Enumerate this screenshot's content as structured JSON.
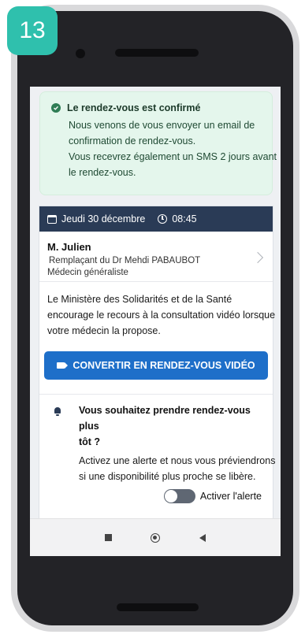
{
  "step_badge": "13",
  "confirmation": {
    "title": "Le rendez-vous est confirmé",
    "lines": [
      "Nous venons de vous envoyer un email de",
      "confirmation de rendez-vous.",
      "Vous recevrez également un SMS 2 jours avant",
      "le rendez-vous."
    ]
  },
  "appointment": {
    "date": "Jeudi 30 décembre",
    "time": "08:45",
    "doctor_name": "M. Julien",
    "doctor_role": "Remplaçant du Dr Mehdi PABAUBOT",
    "specialty": "Médecin généraliste"
  },
  "video_info": {
    "lines": [
      "Le Ministère des Solidarités et de la Santé",
      "encourage le recours à la consultation vidéo lorsque",
      "votre médecin la propose."
    ],
    "button_label": "CONVERTIR EN RENDEZ-VOUS VIDÉO"
  },
  "earlier": {
    "title_lines": [
      "Vous souhaitez prendre rendez-vous plus",
      "tôt ?"
    ],
    "text_lines": [
      "Activez une alerte et nous vous préviendrons",
      "si une disponibilité plus proche se libère."
    ],
    "toggle_label": "Activer l'alerte",
    "toggle_on": false
  },
  "colors": {
    "accent_badge": "#2fc0ad",
    "header_bar": "#2a3b56",
    "button_blue": "#1e6fc9",
    "confirm_green": "#2e7d55"
  }
}
